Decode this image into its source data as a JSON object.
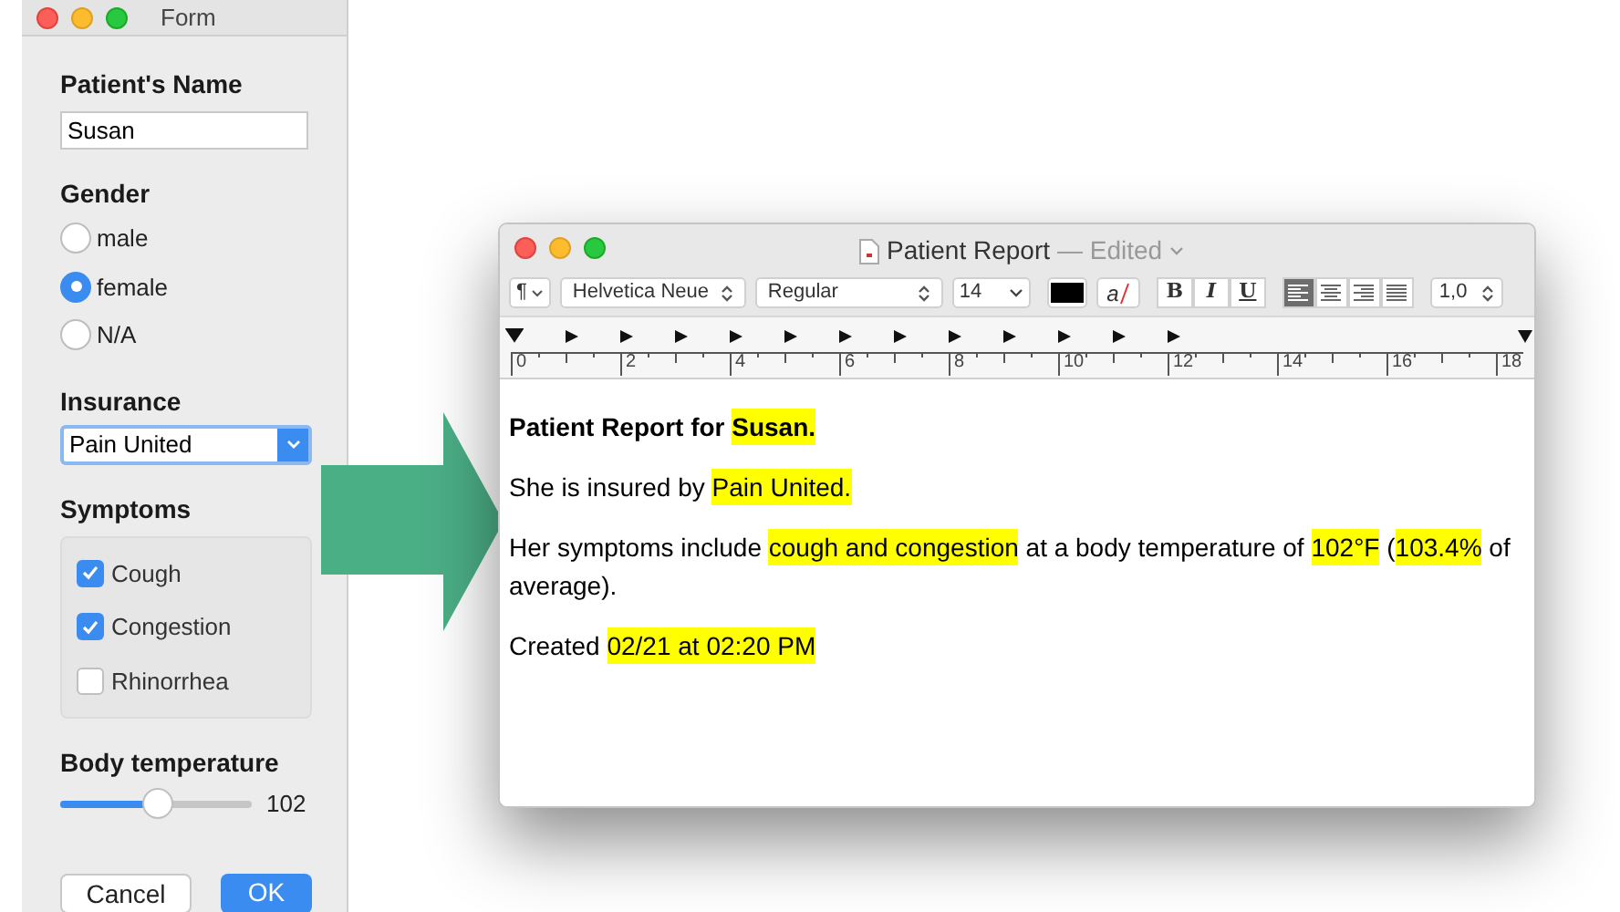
{
  "form_window": {
    "title": "Form",
    "name_field": {
      "label": "Patient's Name",
      "value": "Susan"
    },
    "gender": {
      "label": "Gender",
      "options": [
        {
          "label": "male",
          "selected": false
        },
        {
          "label": "female",
          "selected": true
        },
        {
          "label": "N/A",
          "selected": false
        }
      ]
    },
    "insurance": {
      "label": "Insurance",
      "value": "Pain United"
    },
    "symptoms": {
      "label": "Symptoms",
      "items": [
        {
          "label": "Cough",
          "checked": true
        },
        {
          "label": "Congestion",
          "checked": true
        },
        {
          "label": "Rhinorrhea",
          "checked": false
        }
      ]
    },
    "body_temperature": {
      "label": "Body temperature",
      "level": 0.5,
      "reading": "102"
    },
    "buttons": [
      {
        "label": "Cancel",
        "kind": "secondary"
      },
      {
        "label": "OK",
        "kind": "primary"
      }
    ]
  },
  "report_window": {
    "title": "Patient Report",
    "status": "— Edited",
    "toolbar": {
      "paragraph": "¶",
      "font": "Helvetica Neue",
      "style": "Regular",
      "size": "14",
      "highlight": "a",
      "format_buttons": [
        "B",
        "I",
        "U"
      ],
      "line_spacing": "1,0"
    },
    "ruler_labels": [
      "0",
      "2",
      "4",
      "6",
      "8",
      "10",
      "12",
      "14",
      "16",
      "18"
    ],
    "paragraphs": [
      {
        "bold": true,
        "segments": [
          {
            "text": "Patient Report for ",
            "highlighted": false
          },
          {
            "text": "Susan.",
            "highlighted": true
          }
        ]
      },
      {
        "bold": false,
        "segments": [
          {
            "text": "She is insured by ",
            "highlighted": false
          },
          {
            "text": "Pain United.",
            "highlighted": true
          }
        ]
      },
      {
        "bold": false,
        "segments": [
          {
            "text": "Her symptoms include ",
            "highlighted": false
          },
          {
            "text": "cough and congestion",
            "highlighted": true
          },
          {
            "text": " at a body temperature of ",
            "highlighted": false
          },
          {
            "text": "102°F",
            "highlighted": true
          },
          {
            "text": " (",
            "highlighted": false
          },
          {
            "text": "103.4%",
            "highlighted": true
          },
          {
            "text": " of average).",
            "highlighted": false
          }
        ]
      },
      {
        "bold": false,
        "segments": [
          {
            "text": "Created ",
            "highlighted": false
          },
          {
            "text": "02/21 at 02:20 PM",
            "highlighted": true
          }
        ]
      }
    ]
  }
}
